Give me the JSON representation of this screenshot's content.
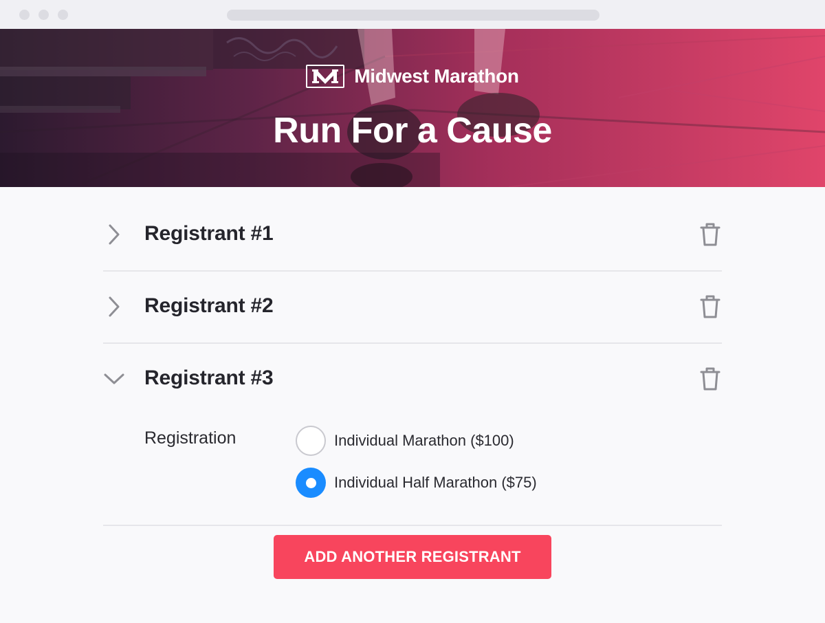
{
  "hero": {
    "brand_mark": "M",
    "brand_name": "Midwest Marathon",
    "title": "Run For a Cause"
  },
  "registrants": [
    {
      "title": "Registrant #1",
      "state": "collapsed",
      "chevron_icon": "chevron-right-icon",
      "delete_icon": "trash-icon"
    },
    {
      "title": "Registrant #2",
      "state": "collapsed",
      "chevron_icon": "chevron-right-icon",
      "delete_icon": "trash-icon"
    },
    {
      "title": "Registrant #3",
      "state": "expanded",
      "chevron_icon": "chevron-down-icon",
      "delete_icon": "trash-icon",
      "registration": {
        "label": "Registration",
        "options": [
          {
            "label": "Individual Marathon ($100)",
            "selected": false
          },
          {
            "label": "Individual Half Marathon ($75)",
            "selected": true
          }
        ]
      }
    }
  ],
  "actions": {
    "add_label": "ADD ANOTHER REGISTRANT"
  },
  "colors": {
    "accent_button": "#f8455d",
    "radio_selected": "#1a8cff",
    "hero_gradient_start": "#2c1a2f",
    "hero_gradient_end": "#e0456a"
  }
}
